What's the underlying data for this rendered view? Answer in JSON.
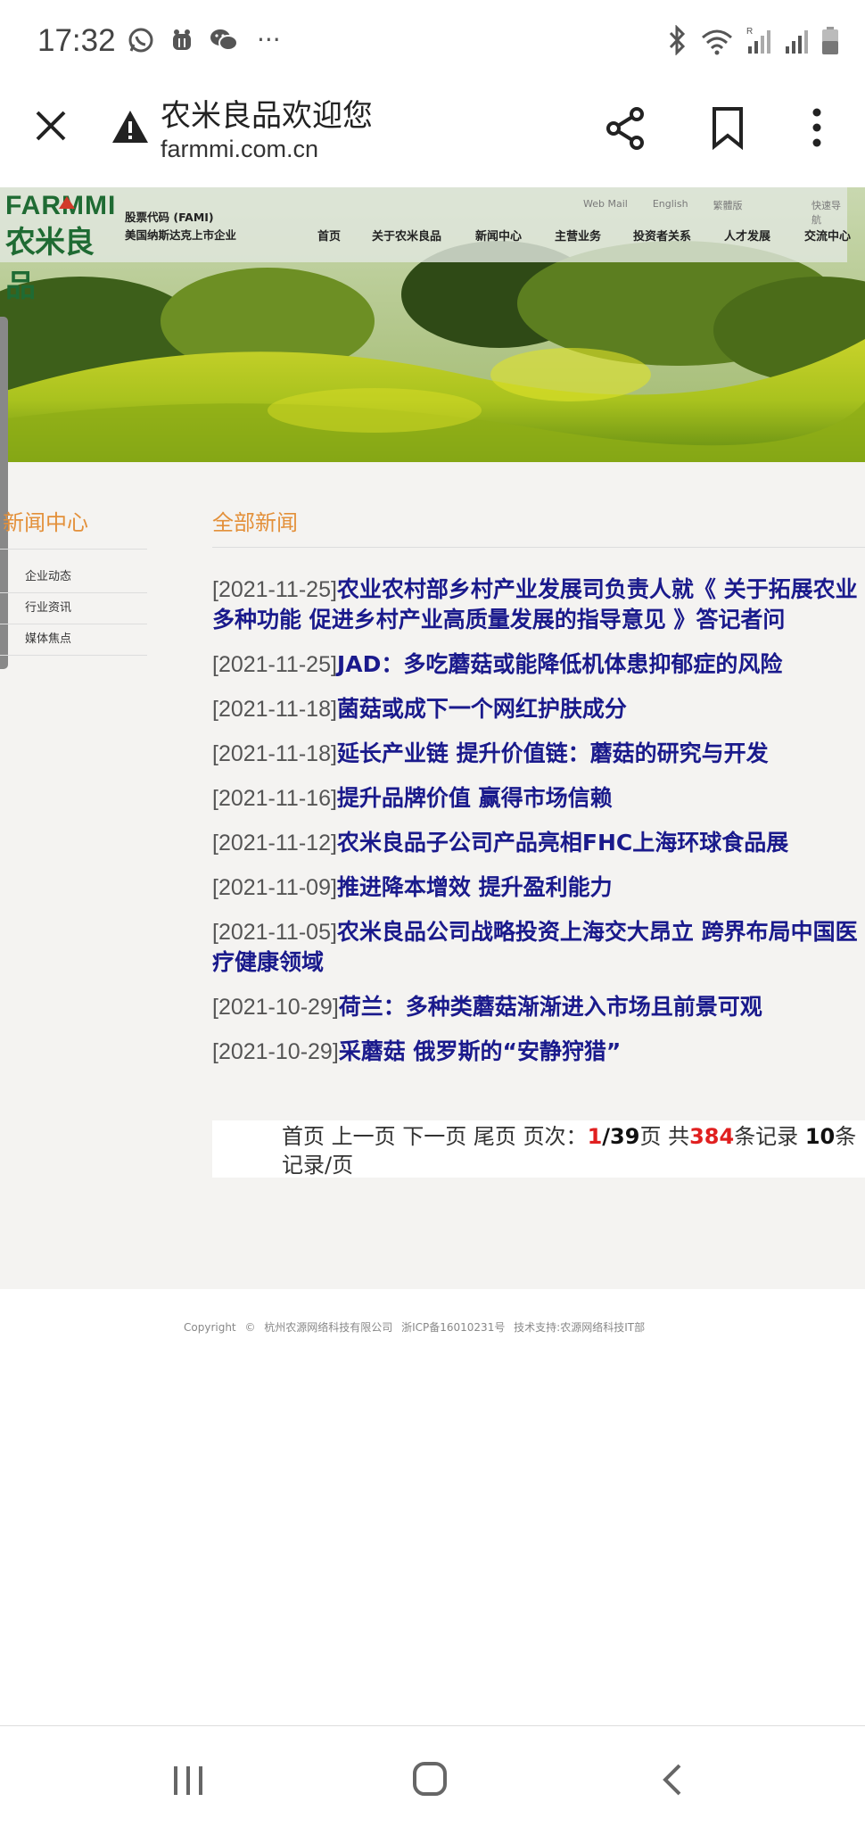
{
  "status_bar": {
    "time": "17:32",
    "more": "···"
  },
  "browser": {
    "title": "农米良品欢迎您",
    "url": "farmmi.com.cn"
  },
  "site": {
    "logo_en": "FARMMI",
    "logo_cn": "农米良品",
    "stock_line1": "股票代码 (FAMI)",
    "stock_line2": "美国纳斯达克上市企业",
    "top_links": [
      "Web Mail",
      "English",
      "繁體版"
    ],
    "quick_nav": "快速导航",
    "nav": [
      "首页",
      "关于农米良品",
      "新闻中心",
      "主营业务",
      "投资者关系",
      "人才发展",
      "交流中心"
    ]
  },
  "sidebar": {
    "title": "新闻中心",
    "items": [
      "企业动态",
      "行业资讯",
      "媒体焦点"
    ]
  },
  "main": {
    "title": "全部新闻",
    "news": [
      {
        "date": "[2021-11-25]",
        "title": "农业农村部乡村产业发展司负责人就《 关于拓展农业多种功能 促进乡村产业高质量发展的指导意见 》答记者问"
      },
      {
        "date": "[2021-11-25]",
        "title": "JAD：多吃蘑菇或能降低机体患抑郁症的风险"
      },
      {
        "date": "[2021-11-18]",
        "title": "菌菇或成下一个网红护肤成分"
      },
      {
        "date": "[2021-11-18]",
        "title": "延长产业链 提升价值链：蘑菇的研究与开发"
      },
      {
        "date": "[2021-11-16]",
        "title": "提升品牌价值 赢得市场信赖"
      },
      {
        "date": "[2021-11-12]",
        "title": "农米良品子公司产品亮相FHC上海环球食品展"
      },
      {
        "date": "[2021-11-09]",
        "title": "推进降本增效 提升盈利能力"
      },
      {
        "date": "[2021-11-05]",
        "title": "农米良品公司战略投资上海交大昂立 跨界布局中国医疗健康领域"
      },
      {
        "date": "[2021-10-29]",
        "title": "荷兰：多种类蘑菇渐渐进入市场且前景可观"
      },
      {
        "date": "[2021-10-29]",
        "title": "采蘑菇 俄罗斯的“安静狩猎”"
      }
    ],
    "pager": {
      "first": "首页",
      "prev": "上一页",
      "next": "下一页",
      "last": "尾页",
      "page_label": "页次：",
      "current": "1",
      "total_pages": "/39",
      "page_suffix": "页",
      "total_prefix": "共",
      "total_records": "384",
      "records_suffix": "条记录",
      "per_page": "10",
      "per_page_suffix": "条记录/页"
    }
  },
  "footer": {
    "copyright": "Copyright © 杭州农源网络科技有限公司",
    "icp": "浙ICP备16010231号",
    "support": "技术支持:农源网络科技IT部"
  }
}
